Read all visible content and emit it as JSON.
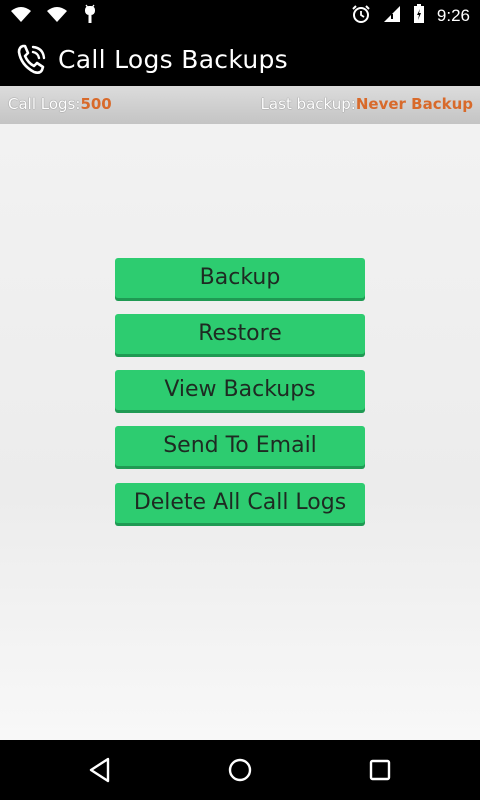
{
  "statusbar": {
    "time": "9:26",
    "icons_left": [
      "wifi-icon",
      "wifi-icon",
      "android-debug-icon"
    ],
    "icons_right": [
      "alarm-icon",
      "signal-icon",
      "battery-icon"
    ]
  },
  "actionbar": {
    "title": "Call Logs Backups",
    "icon": "phone-call-icon"
  },
  "infobar": {
    "call_logs_label": "Call Logs:",
    "call_logs_value": "500",
    "last_backup_label": "Last backup:",
    "last_backup_value": "Never Backup"
  },
  "buttons": {
    "backup": "Backup",
    "restore": "Restore",
    "view_backups": "View Backups",
    "send_to_email": "Send To Email",
    "delete_all": "Delete All Call Logs"
  },
  "navbar": {
    "icons": [
      "back-icon",
      "home-icon",
      "recents-icon"
    ]
  },
  "colors": {
    "button_green": "#2dcc70",
    "accent_orange": "#d86a2b"
  }
}
